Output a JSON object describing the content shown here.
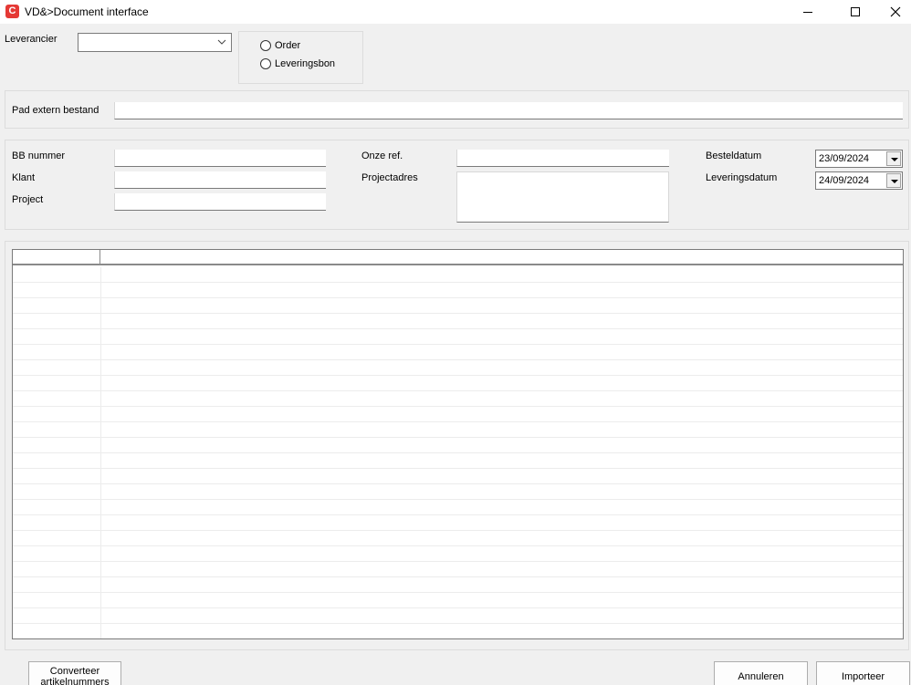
{
  "window": {
    "icon_letter": "C",
    "title": "VD&>Document interface"
  },
  "supplier": {
    "label": "Leverancier",
    "value": ""
  },
  "doc_type": {
    "options": [
      "Order",
      "Leveringsbon"
    ]
  },
  "path": {
    "label": "Pad extern bestand",
    "value": ""
  },
  "details": {
    "bb_label": "BB nummer",
    "bb_value": "",
    "client_label": "Klant",
    "client_value": "",
    "project_label": "Project",
    "project_value": "",
    "our_ref_label": "Onze ref.",
    "our_ref_value": "",
    "project_address_label": "Projectadres",
    "project_address_value": "",
    "order_date_label": "Besteldatum",
    "order_date_value": "23/09/2024",
    "delivery_date_label": "Leveringsdatum",
    "delivery_date_value": "24/09/2024"
  },
  "buttons": {
    "convert_line1": "Converteer",
    "convert_line2": "artikelnummers",
    "cancel": "Annuleren",
    "import": "Importeer"
  }
}
